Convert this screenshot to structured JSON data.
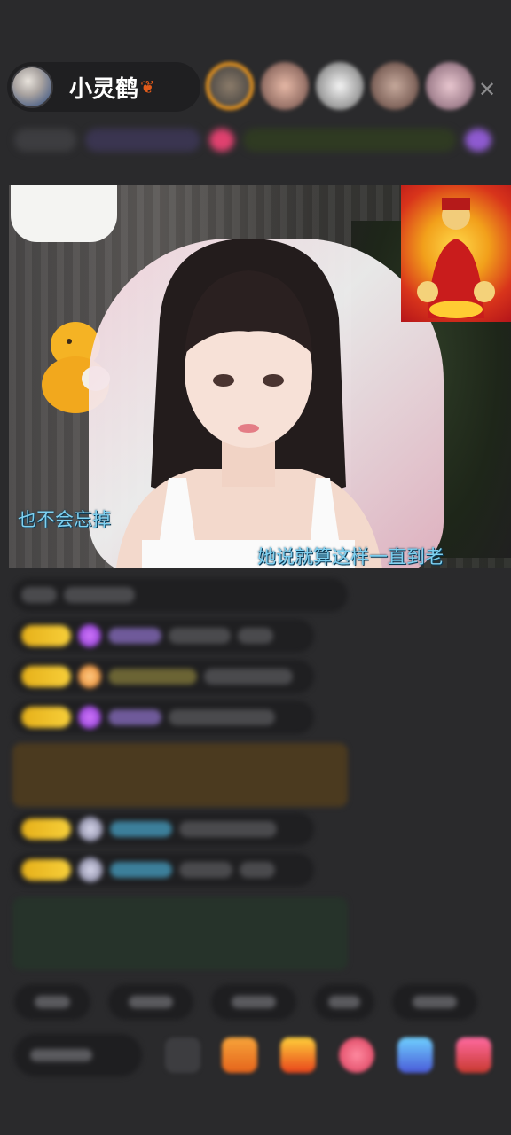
{
  "header": {
    "host_name": "小灵鹤",
    "host_badge_icon": "maple-leaf-icon",
    "close_icon": "close-icon",
    "viewer_count_shown": 5
  },
  "video": {
    "subtitle_left": "也不会忘掉",
    "subtitle_right": "她说就算这样一直到老"
  },
  "colors": {
    "background": "#2a2a2c",
    "accent_gold": "#f7cf3a",
    "subtitle_blue": "#7ed0f0",
    "close_gray": "#8c8c8e"
  },
  "bottom_bar": {
    "icons": [
      "more-icon",
      "gift-box-icon",
      "red-packet-icon",
      "lips-icon",
      "gem-icon",
      "treasure-icon"
    ]
  }
}
